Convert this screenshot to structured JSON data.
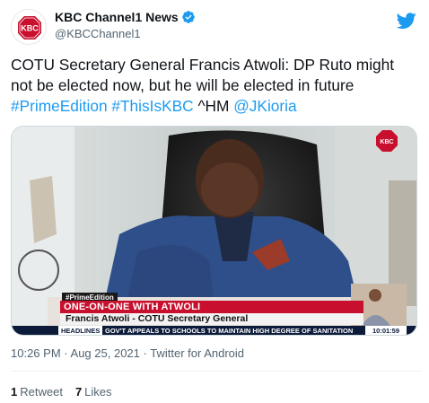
{
  "account": {
    "name": "KBC Channel1 News",
    "handle": "@KBCChannel1",
    "logo_text": "KBC"
  },
  "tweet": {
    "text_line1": "COTU Secretary General Francis Atwoli: DP Ruto might",
    "text_line2": "not be elected now, but he will be elected in future",
    "hashtag1": "#PrimeEdition",
    "hashtag2": "#ThisIsKBC",
    "signoff": "^HM",
    "mention": "@JKioria"
  },
  "video": {
    "channel_bug": "KBC",
    "segment_tag": "#PrimeEdition",
    "headline": "ONE-ON-ONE WITH ATWOLI",
    "name_strap": "Francis Atwoli - COTU Secretary General",
    "ticker_label": "HEADLINES",
    "ticker_text": "GOV'T APPEALS TO SCHOOLS TO MAINTAIN HIGH DEGREE OF SANITATION",
    "clock": "10:01:59"
  },
  "meta": {
    "time": "10:26 PM",
    "separator": "·",
    "date": "Aug 25, 2021",
    "source": "Twitter for Android"
  },
  "stats": {
    "retweets_count": "1",
    "retweets_label": "Retweet",
    "likes_count": "7",
    "likes_label": "Likes"
  },
  "colors": {
    "link": "#1d9bf0",
    "verified": "#1d9bf0",
    "kbc_red": "#c8102e",
    "ticker_navy": "#0d1b3a"
  },
  "icons": [
    "verified-badge-icon",
    "twitter-bird-icon",
    "kbc-logo"
  ]
}
